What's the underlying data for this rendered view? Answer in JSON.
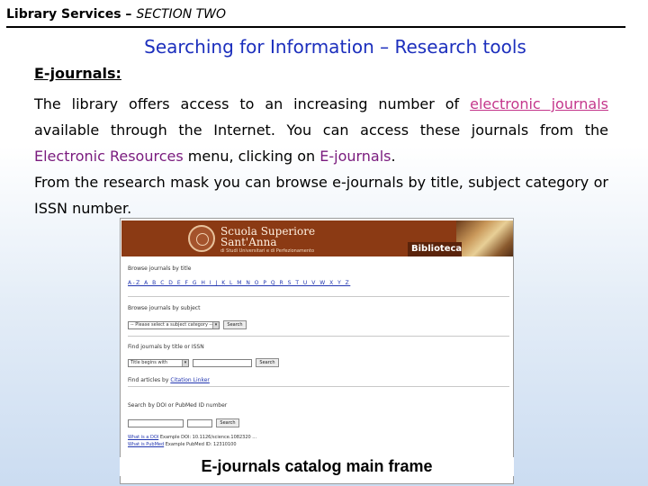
{
  "header": {
    "bold": "Library Services –",
    "italic": "SECTION TWO"
  },
  "title": "Searching for Information – Research tools",
  "section_heading": "E-journals:",
  "paragraph": {
    "p1_a": "The library offers access to an increasing number of ",
    "p1_link": "electronic journals",
    "p1_b": " available through the Internet. You can access these journals from the ",
    "p1_menu": "Electronic Resources",
    "p1_c": " menu, clicking on ",
    "p1_item": "E-journals",
    "p1_d": ".",
    "p2": "From the research mask you can browse e-journals by title, subject category or ISSN number."
  },
  "screenshot": {
    "institution_line1": "Scuola Superiore",
    "institution_line2": "Sant'Anna",
    "institution_line3": "di Studi Universitari e di Perfezionamento",
    "banner_label": "Biblioteca",
    "browse_title_label": "Browse journals by title",
    "az_links": "A-Z  A B C D E F G H I J K L M N O P Q R S T U V W X Y Z",
    "browse_subject_label": "Browse journals by subject",
    "subject_select": "-- Please select a subject category --",
    "search_btn_1": "Search",
    "find_label": "Find journals by title or ISSN",
    "title_select": "Title begins with",
    "search_btn_2": "Search",
    "find_articles_label": "Find articles by",
    "find_articles_link": "Citation Linker",
    "doi_label": "Search by DOI or PubMed ID number",
    "search_btn_3": "Search",
    "footer_link_1": "What is a DOI",
    "footer_text_1": "Example DOI: 10.1126/science.1082320 ...",
    "footer_link_2": "What is PubMed",
    "footer_text_2": "Example PubMed ID: 12310100"
  },
  "caption": "E-journals catalog main frame"
}
